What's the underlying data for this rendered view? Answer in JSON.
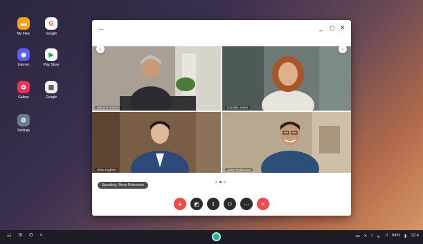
{
  "desktop": {
    "icons": [
      {
        "label": "My Files",
        "color": "#f2a51a",
        "glyph": "▬"
      },
      {
        "label": "Google",
        "color": "#ffffff",
        "glyph": "G"
      },
      {
        "label": "Internet",
        "color": "#5a5ff0",
        "glyph": "◉"
      },
      {
        "label": "Play Store",
        "color": "#ffffff",
        "glyph": "▶"
      },
      {
        "label": "Gallery",
        "color": "#e8325a",
        "glyph": "✿"
      },
      {
        "label": "Google",
        "color": "#f0f0f0",
        "glyph": "▦"
      },
      {
        "label": "Settings",
        "color": "#6a7a90",
        "glyph": "⚙"
      }
    ]
  },
  "window": {
    "back_icon": "←",
    "minimize": "_",
    "maximize": "◻",
    "close": "✕",
    "participants": [
      {
        "name": "Marjorie Stewart",
        "bg": "#a89f95",
        "skin": "#c79a7a",
        "hair": "#bdbdbd",
        "shirt": "#2b2b2f"
      },
      {
        "name": "Caroline Jones",
        "bg": "#6e7a78",
        "skin": "#e0b08a",
        "hair": "#a8552a",
        "shirt": "#e8e3dc"
      },
      {
        "name": "Shao Hughes",
        "bg": "#7a5d45",
        "skin": "#e0b79a",
        "hair": "#1a1a1a",
        "shirt": "#2d4a7a"
      },
      {
        "name": "Jason Robertson",
        "bg": "#b9a890",
        "skin": "#c59878",
        "hair": "#2a1f1a",
        "shirt": "#2c4f78"
      }
    ],
    "speaking_label": "Speaking: Steve Robertson",
    "controls": [
      {
        "name": "mic",
        "glyph": "🎤︎",
        "color": "#ef4b4b"
      },
      {
        "name": "camera",
        "glyph": "◩",
        "color": "#2b2b2b"
      },
      {
        "name": "share",
        "glyph": "⇪",
        "color": "#2b2b2b"
      },
      {
        "name": "participants",
        "glyph": "⚇",
        "color": "#2b2b2b"
      },
      {
        "name": "more",
        "glyph": "⋯",
        "color": "#2b2b2b"
      },
      {
        "name": "end",
        "glyph": "✕",
        "color": "#ef4b4b"
      }
    ]
  },
  "taskbar": {
    "left": [
      "☷",
      "III",
      "O",
      "<"
    ],
    "right": [
      "◂◂",
      "✕",
      "|",
      "ᯤ",
      ".ıl",
      "64%",
      "▮",
      "12:4"
    ]
  }
}
